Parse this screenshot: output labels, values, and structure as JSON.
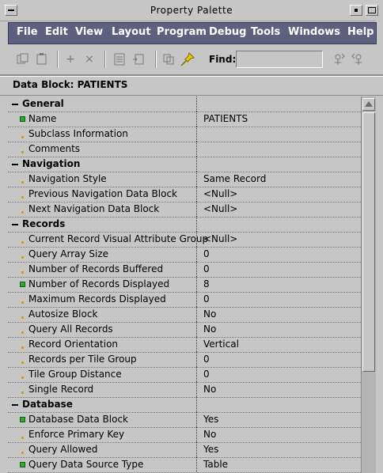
{
  "window": {
    "title": "Property Palette"
  },
  "menu": {
    "items": [
      {
        "id": "file",
        "label": "File"
      },
      {
        "id": "edit",
        "label": "Edit"
      },
      {
        "id": "view",
        "label": "View"
      },
      {
        "id": "layout",
        "label": "Layout"
      },
      {
        "id": "program",
        "label": "Program"
      },
      {
        "id": "debug",
        "label": "Debug"
      },
      {
        "id": "tools",
        "label": "Tools"
      },
      {
        "id": "windows",
        "label": "Windows"
      },
      {
        "id": "help",
        "label": "Help"
      }
    ]
  },
  "toolbar": {
    "find_label": "Find:",
    "find_value": "",
    "icons": [
      "copy-properties-icon",
      "paste-properties-icon",
      "add-property-icon",
      "delete-property-icon",
      "property-class-icon",
      "inherit-icon",
      "intersection-union-icon",
      "freeze-pin-icon",
      "find-forward-icon",
      "find-backward-icon"
    ]
  },
  "block_label": "Data Block: PATIENTS",
  "rows": [
    {
      "type": "category",
      "label": "General"
    },
    {
      "type": "property",
      "label": "Name",
      "value": "PATIENTS",
      "marker": "changed"
    },
    {
      "type": "property",
      "label": "Subclass Information",
      "value": "",
      "marker": "default"
    },
    {
      "type": "property",
      "label": "Comments",
      "value": "",
      "marker": "default"
    },
    {
      "type": "category",
      "label": "Navigation"
    },
    {
      "type": "property",
      "label": "Navigation Style",
      "value": "Same Record",
      "marker": "default"
    },
    {
      "type": "property",
      "label": "Previous Navigation Data Block",
      "value": "<Null>",
      "marker": "default"
    },
    {
      "type": "property",
      "label": "Next Navigation Data Block",
      "value": "<Null>",
      "marker": "default"
    },
    {
      "type": "category",
      "label": "Records"
    },
    {
      "type": "property",
      "label": "Current Record Visual Attribute Group",
      "value": "<Null>",
      "marker": "default"
    },
    {
      "type": "property",
      "label": "Query Array Size",
      "value": "0",
      "marker": "default"
    },
    {
      "type": "property",
      "label": "Number of Records Buffered",
      "value": "0",
      "marker": "default"
    },
    {
      "type": "property",
      "label": "Number of Records Displayed",
      "value": "8",
      "marker": "changed"
    },
    {
      "type": "property",
      "label": "Maximum Records Displayed",
      "value": "0",
      "marker": "default"
    },
    {
      "type": "property",
      "label": "Autosize Block",
      "value": "No",
      "marker": "default"
    },
    {
      "type": "property",
      "label": "Query All Records",
      "value": "No",
      "marker": "default"
    },
    {
      "type": "property",
      "label": "Record Orientation",
      "value": "Vertical",
      "marker": "default"
    },
    {
      "type": "property",
      "label": "Records per Tile Group",
      "value": "0",
      "marker": "default"
    },
    {
      "type": "property",
      "label": "Tile Group Distance",
      "value": "0",
      "marker": "default"
    },
    {
      "type": "property",
      "label": "Single Record",
      "value": "No",
      "marker": "default"
    },
    {
      "type": "category",
      "label": "Database"
    },
    {
      "type": "property",
      "label": "Database Data Block",
      "value": "Yes",
      "marker": "changed"
    },
    {
      "type": "property",
      "label": "Enforce Primary Key",
      "value": "No",
      "marker": "default"
    },
    {
      "type": "property",
      "label": "Query Allowed",
      "value": "Yes",
      "marker": "default"
    },
    {
      "type": "property",
      "label": "Query Data Source Type",
      "value": "Table",
      "marker": "changed"
    }
  ],
  "colors": {
    "menubar_bg": "#5f5f7f",
    "window_bg": "#c6c6c6",
    "changed_marker": "#2faa2f",
    "default_marker": "#c8a000"
  }
}
